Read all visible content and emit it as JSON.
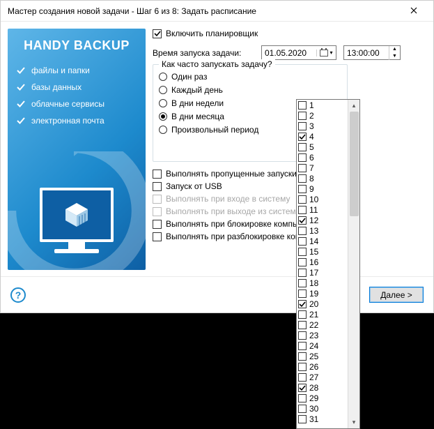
{
  "window": {
    "title": "Мастер создания новой задачи - Шаг 6 из 8: Задать расписание"
  },
  "sidebar": {
    "title": "HANDY BACKUP",
    "features": [
      "файлы и папки",
      "базы данных",
      "облачные сервисы",
      "электронная почта"
    ]
  },
  "scheduler": {
    "enable_label": "Включить планировщик",
    "enabled": true,
    "start_label": "Время запуска задачи:",
    "date_value": "01.05.2020",
    "time_value": "13:00:00",
    "freq_group_title": "Как часто запускать задачу?",
    "freq_options": [
      {
        "label": "Один раз",
        "selected": false
      },
      {
        "label": "Каждый день",
        "selected": false
      },
      {
        "label": "В дни недели",
        "selected": false
      },
      {
        "label": "В дни месяца",
        "selected": true
      },
      {
        "label": "Произвольный период",
        "selected": false
      }
    ],
    "options": [
      {
        "label": "Выполнять пропущенные запуски",
        "checked": false,
        "enabled": true
      },
      {
        "label": "Запуск от USB",
        "checked": false,
        "enabled": true
      },
      {
        "label": "Выполнять при входе в систему",
        "checked": false,
        "enabled": false
      },
      {
        "label": "Выполнять при выходе из системы",
        "checked": false,
        "enabled": false
      },
      {
        "label": "Выполнять при блокировке компьютера",
        "checked": false,
        "enabled": true
      },
      {
        "label": "Выполнять при разблокировке компьютера",
        "checked": false,
        "enabled": true
      }
    ]
  },
  "days": [
    {
      "n": "1",
      "c": false
    },
    {
      "n": "2",
      "c": false
    },
    {
      "n": "3",
      "c": false
    },
    {
      "n": "4",
      "c": true
    },
    {
      "n": "5",
      "c": false
    },
    {
      "n": "6",
      "c": false
    },
    {
      "n": "7",
      "c": false
    },
    {
      "n": "8",
      "c": false
    },
    {
      "n": "9",
      "c": false
    },
    {
      "n": "10",
      "c": false
    },
    {
      "n": "11",
      "c": false
    },
    {
      "n": "12",
      "c": true
    },
    {
      "n": "13",
      "c": false
    },
    {
      "n": "14",
      "c": false
    },
    {
      "n": "15",
      "c": false
    },
    {
      "n": "16",
      "c": false
    },
    {
      "n": "17",
      "c": false
    },
    {
      "n": "18",
      "c": false
    },
    {
      "n": "19",
      "c": false
    },
    {
      "n": "20",
      "c": true
    },
    {
      "n": "21",
      "c": false
    },
    {
      "n": "22",
      "c": false
    },
    {
      "n": "23",
      "c": false
    },
    {
      "n": "24",
      "c": false
    },
    {
      "n": "25",
      "c": false
    },
    {
      "n": "26",
      "c": false
    },
    {
      "n": "27",
      "c": false
    },
    {
      "n": "28",
      "c": true
    },
    {
      "n": "29",
      "c": false
    },
    {
      "n": "30",
      "c": false
    },
    {
      "n": "31",
      "c": false
    }
  ],
  "footer": {
    "help": "?",
    "next_label": "Далее >"
  }
}
